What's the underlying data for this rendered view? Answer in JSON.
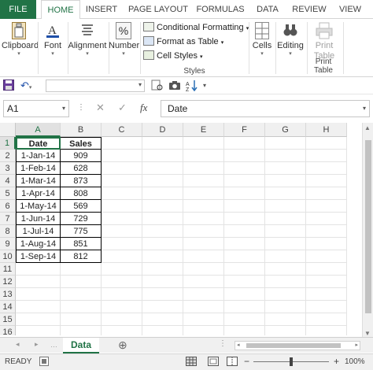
{
  "ribbon_tabs": [
    "FILE",
    "HOME",
    "INSERT",
    "PAGE LAYOUT",
    "FORMULAS",
    "DATA",
    "REVIEW",
    "VIEW"
  ],
  "ribbon": {
    "clipboard": "Clipboard",
    "font": "Font",
    "alignment": "Alignment",
    "number": "Number",
    "conditional_formatting": "Conditional Formatting",
    "format_as_table": "Format as Table",
    "cell_styles": "Cell Styles",
    "styles_group": "Styles",
    "cells": "Cells",
    "editing": "Editing",
    "print_table_btn_line1": "Print",
    "print_table_btn_line2": "Table",
    "print_table_group": "Print Table"
  },
  "formula_bar": {
    "name_box": "A1",
    "cancel": "✕",
    "enter": "✓",
    "fx": "fx",
    "content": "Date"
  },
  "columns": [
    "A",
    "B",
    "C",
    "D",
    "E",
    "F",
    "G",
    "H"
  ],
  "rows": [
    "1",
    "2",
    "3",
    "4",
    "5",
    "6",
    "7",
    "8",
    "9",
    "10",
    "11",
    "12",
    "13",
    "14",
    "15",
    "16"
  ],
  "table": {
    "headers": [
      "Date",
      "Sales"
    ],
    "data": [
      [
        "1-Jan-14",
        "909"
      ],
      [
        "1-Feb-14",
        "628"
      ],
      [
        "1-Mar-14",
        "873"
      ],
      [
        "1-Apr-14",
        "808"
      ],
      [
        "1-May-14",
        "569"
      ],
      [
        "1-Jun-14",
        "729"
      ],
      [
        "1-Jul-14",
        "775"
      ],
      [
        "1-Aug-14",
        "851"
      ],
      [
        "1-Sep-14",
        "812"
      ]
    ]
  },
  "sheet_tab": "Data",
  "add_sheet": "⊕",
  "status": {
    "ready": "READY",
    "zoom": "100%",
    "zoom_minus": "−",
    "zoom_plus": "+"
  },
  "colors": {
    "accent": "#217346"
  }
}
